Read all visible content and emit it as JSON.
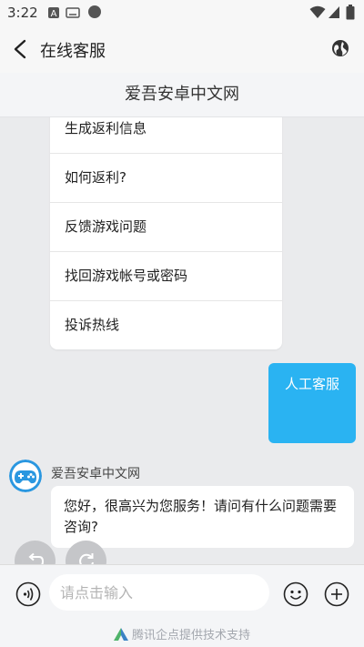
{
  "status_bar": {
    "time": "3:22",
    "icons": [
      "a-notification-icon",
      "keyboard-icon",
      "dot-icon",
      "wifi-icon",
      "signal-icon",
      "battery-icon"
    ]
  },
  "header": {
    "title": "在线客服",
    "back_icon": "chevron-left-icon",
    "globe_icon": "globe-icon"
  },
  "subheader": {
    "title": "爱吾安卓中文网"
  },
  "quick_menu": {
    "items": [
      {
        "label": "生成返利信息"
      },
      {
        "label": "如何返利?"
      },
      {
        "label": "反馈游戏问题"
      },
      {
        "label": "找回游戏帐号或密码"
      },
      {
        "label": "投诉热线"
      }
    ]
  },
  "messages": {
    "user_message": "人工客服",
    "bot_name": "爱吾安卓中文网",
    "bot_message": "您好，很高兴为您服务！请问有什么问题需要咨询?"
  },
  "input": {
    "placeholder": "请点击输入",
    "value": ""
  },
  "footer": {
    "text": "腾讯企点提供技术支持"
  },
  "colors": {
    "accent": "#2ab3f2",
    "background": "#eaebed",
    "fab": "#c5c6c9"
  }
}
